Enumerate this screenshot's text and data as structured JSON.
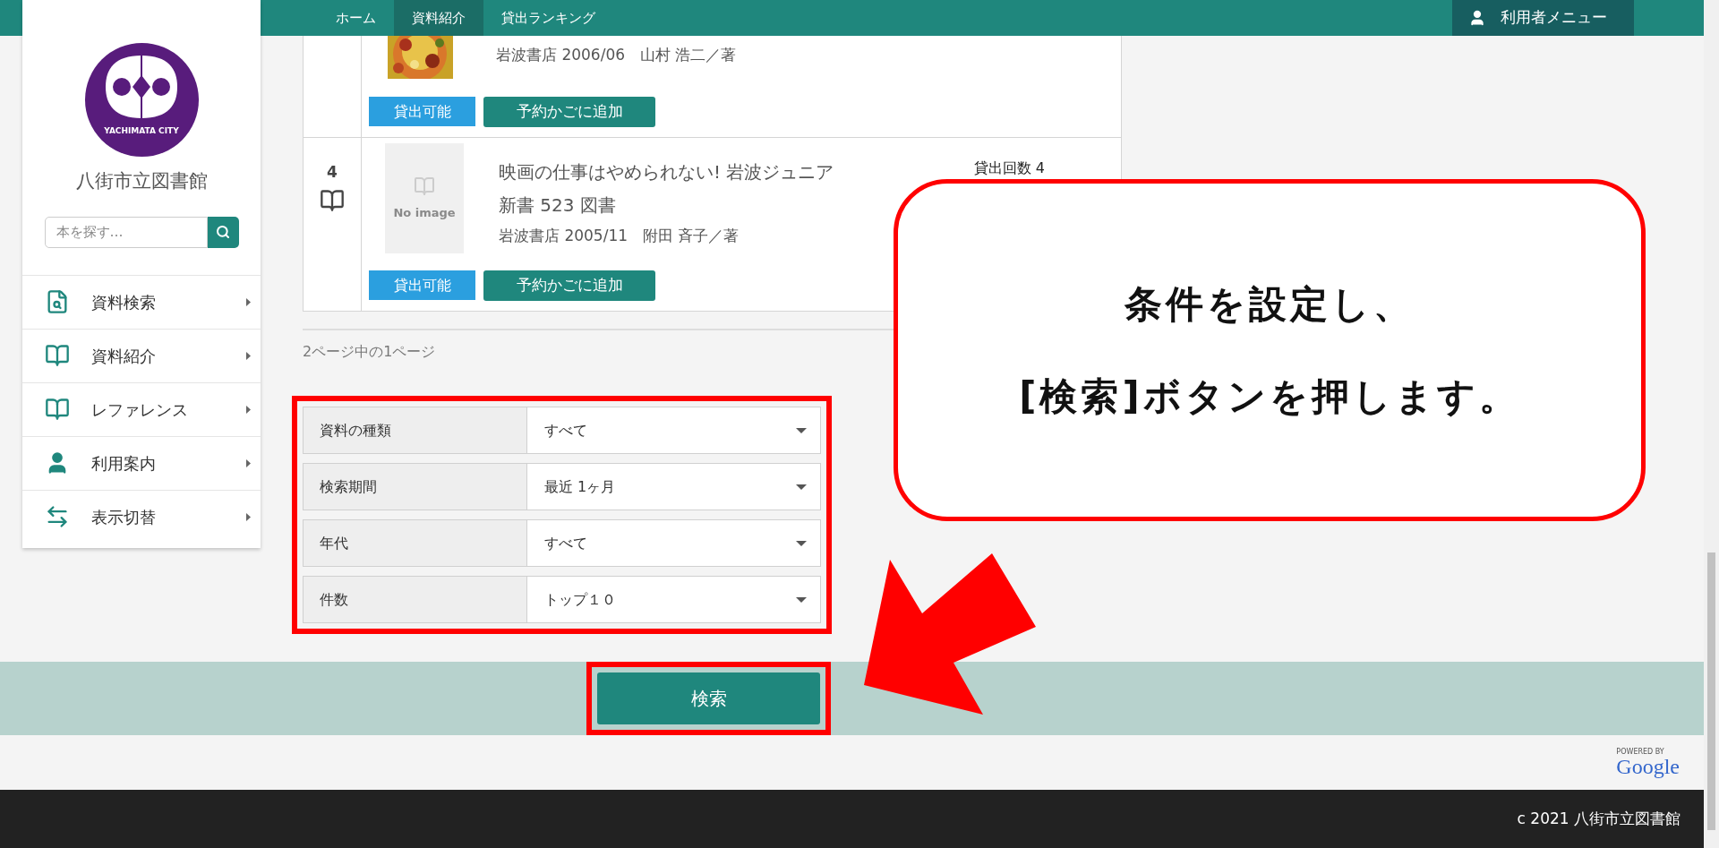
{
  "breadcrumb": [
    {
      "label": "ホーム",
      "selected": false
    },
    {
      "label": "資料紹介",
      "selected": true
    },
    {
      "label": "貸出ランキング",
      "selected": false
    }
  ],
  "user_menu": "利用者メニュー",
  "sidebar": {
    "logo_text": "YACHIMATA CITY",
    "library_name": "八街市立図書館",
    "search": {
      "placeholder": "本を探す…"
    },
    "items": [
      {
        "label": "資料検索",
        "kind": "search"
      },
      {
        "label": "資料紹介",
        "kind": "book"
      },
      {
        "label": "レファレンス",
        "kind": "book"
      },
      {
        "label": "利用案内",
        "kind": "person"
      },
      {
        "label": "表示切替",
        "kind": "swap"
      }
    ]
  },
  "results": [
    {
      "kind": "picture",
      "meta": "岩波書店 2006/06　山村 浩二／著",
      "status": "貸出可能",
      "action": "予約かごに追加"
    },
    {
      "rank": "4",
      "kind": "no_image",
      "no_image": "No image",
      "title": "映画の仕事はやめられない! 岩波ジュニア",
      "title_2": "新書 523 図書",
      "meta": "岩波書店 2005/11　附田 斉子／著",
      "count": "貸出回数 4",
      "status": "貸出可能",
      "action": "予約かごに追加"
    }
  ],
  "pagination": "2ページ中の1ページ",
  "filters": [
    {
      "label": "資料の種類",
      "value": "すべて"
    },
    {
      "label": "検索期間",
      "value": "最近 1ヶ月"
    },
    {
      "label": "年代",
      "value": "すべて"
    },
    {
      "label": "件数",
      "value": "トップ１０"
    }
  ],
  "search_button": "検索",
  "callout": [
    "条件を設定し、",
    "[検索]ボタンを押します。"
  ],
  "powered_by": "POWERED BY",
  "google": "Google",
  "footer": "c 2021 八街市立図書館"
}
